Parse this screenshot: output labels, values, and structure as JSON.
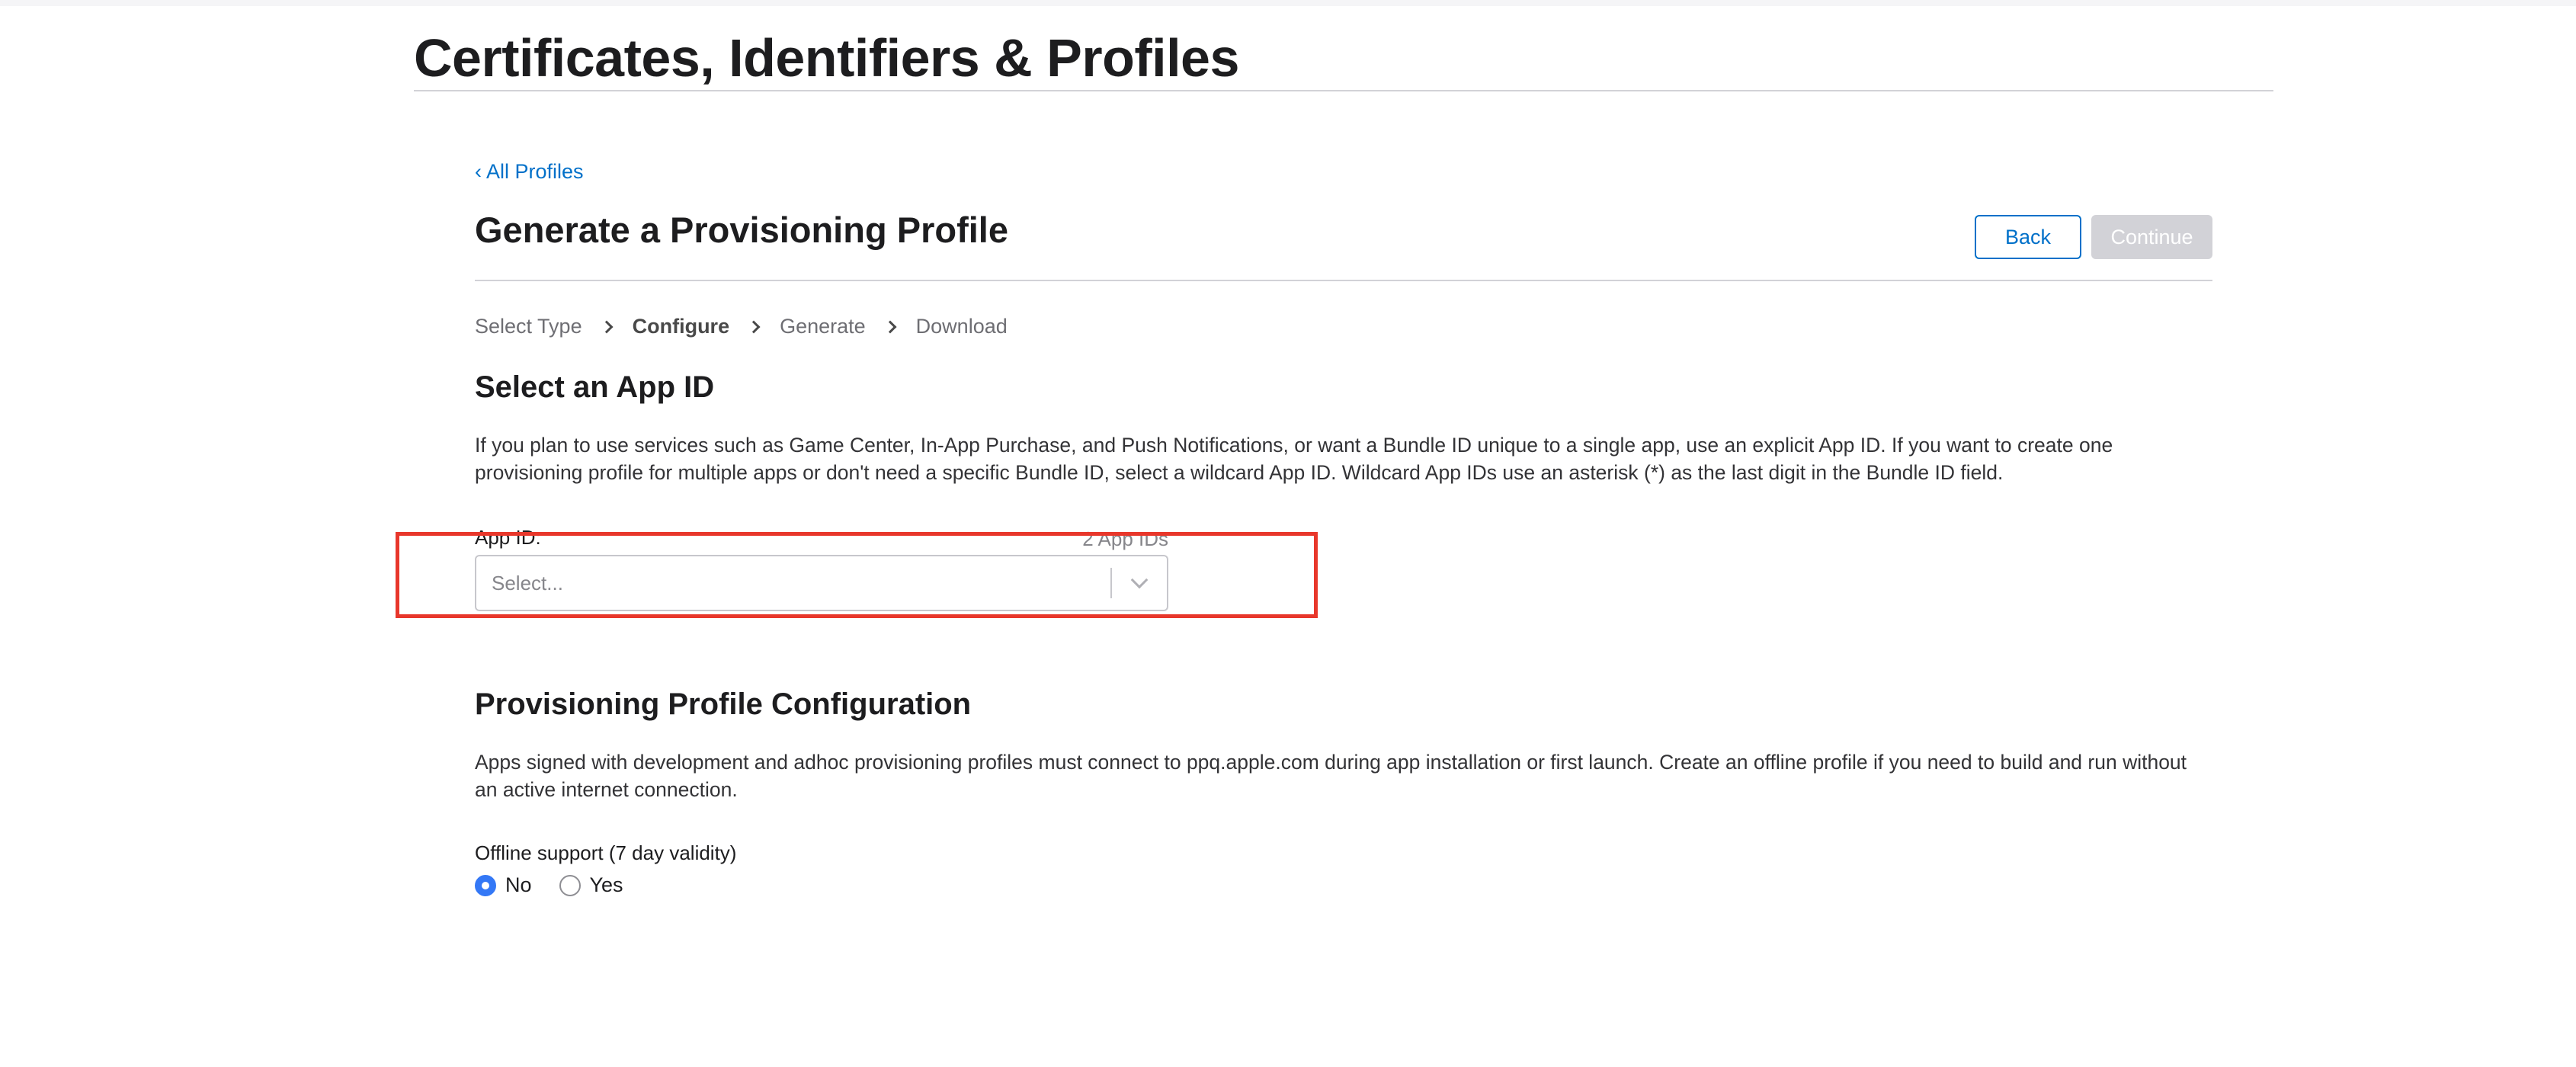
{
  "page": {
    "title": "Certificates, Identifiers & Profiles"
  },
  "nav": {
    "back_link": "‹ All Profiles"
  },
  "header": {
    "title": "Generate a Provisioning Profile",
    "back_label": "Back",
    "continue_label": "Continue"
  },
  "steps": [
    {
      "label": "Select Type",
      "active": false
    },
    {
      "label": "Configure",
      "active": true
    },
    {
      "label": "Generate",
      "active": false
    },
    {
      "label": "Download",
      "active": false
    }
  ],
  "app_id_section": {
    "title": "Select an App ID",
    "description": "If you plan to use services such as Game Center, In-App Purchase, and Push Notifications, or want a Bundle ID unique to a single app, use an explicit App ID. If you want to create one provisioning profile for multiple apps or don't need a specific Bundle ID, select a wildcard App ID. Wildcard App IDs use an asterisk (*) as the last digit in the Bundle ID field.",
    "field_label": "App ID:",
    "count": "2 App IDs",
    "select_placeholder": "Select..."
  },
  "config_section": {
    "title": "Provisioning Profile Configuration",
    "description": "Apps signed with development and adhoc provisioning profiles must connect to ppq.apple.com during app installation or first launch. Create an offline profile if you need to build and run without an active internet connection.",
    "offline_label": "Offline support (7 day validity)",
    "options": [
      {
        "label": "No",
        "checked": true
      },
      {
        "label": "Yes",
        "checked": false
      }
    ]
  },
  "colors": {
    "link": "#0070c9",
    "highlight": "#e8372b",
    "radio_checked": "#3478f6"
  }
}
